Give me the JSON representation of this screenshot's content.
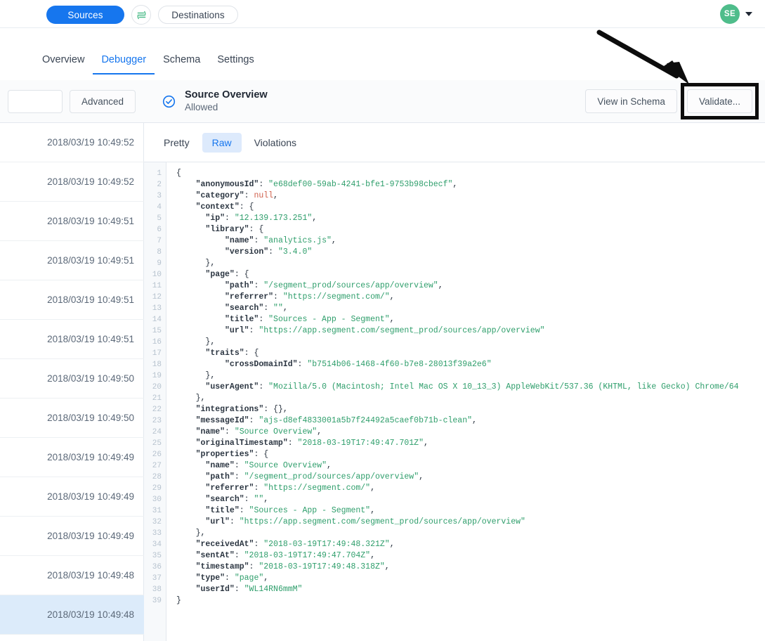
{
  "topbar": {
    "sources_label": "Sources",
    "destinations_label": "Destinations",
    "sync_icon": "sync-icon",
    "avatar_initials": "SE",
    "caret_icon": "chevron-down-icon"
  },
  "nav": {
    "tabs": [
      {
        "label": "Overview",
        "active": false
      },
      {
        "label": "Debugger",
        "active": true
      },
      {
        "label": "Schema",
        "active": false
      },
      {
        "label": "Settings",
        "active": false
      }
    ]
  },
  "left_panel": {
    "search_value": "",
    "search_placeholder": "",
    "advanced_label": "Advanced",
    "events": [
      {
        "timestamp": "2018/03/19 10:49:52",
        "selected": false
      },
      {
        "timestamp": "2018/03/19 10:49:52",
        "selected": false
      },
      {
        "timestamp": "2018/03/19 10:49:51",
        "selected": false
      },
      {
        "timestamp": "2018/03/19 10:49:51",
        "selected": false
      },
      {
        "timestamp": "2018/03/19 10:49:51",
        "selected": false
      },
      {
        "timestamp": "2018/03/19 10:49:51",
        "selected": false
      },
      {
        "timestamp": "2018/03/19 10:49:50",
        "selected": false
      },
      {
        "timestamp": "2018/03/19 10:49:50",
        "selected": false
      },
      {
        "timestamp": "2018/03/19 10:49:49",
        "selected": false
      },
      {
        "timestamp": "2018/03/19 10:49:49",
        "selected": false
      },
      {
        "timestamp": "2018/03/19 10:49:49",
        "selected": false
      },
      {
        "timestamp": "2018/03/19 10:49:48",
        "selected": false
      },
      {
        "timestamp": "2018/03/19 10:49:48",
        "selected": true
      }
    ]
  },
  "detail": {
    "status_icon": "check-circle-icon",
    "title": "Source Overview",
    "subtitle": "Allowed",
    "view_in_schema_label": "View in Schema",
    "validate_label": "Validate...",
    "view_tabs": [
      {
        "label": "Pretty",
        "active": false
      },
      {
        "label": "Raw",
        "active": true
      },
      {
        "label": "Violations",
        "active": false
      }
    ]
  },
  "annotation": {
    "arrow_icon": "arrow-pointer-icon",
    "highlight_target": "validate-button"
  },
  "code": {
    "lines": [
      {
        "num": "1",
        "tokens": [
          {
            "t": "{",
            "c": "p",
            "indent": 0
          }
        ]
      },
      {
        "num": "2",
        "tokens": [
          {
            "t": "\"anonymousId\"",
            "c": "k",
            "indent": 2
          },
          {
            "t": ": ",
            "c": "p"
          },
          {
            "t": "\"e68def00-59ab-4241-bfe1-9753b98cbecf\"",
            "c": "s"
          },
          {
            "t": ",",
            "c": "p"
          }
        ]
      },
      {
        "num": "3",
        "tokens": [
          {
            "t": "\"category\"",
            "c": "k",
            "indent": 2
          },
          {
            "t": ": ",
            "c": "p"
          },
          {
            "t": "null",
            "c": "n"
          },
          {
            "t": ",",
            "c": "p"
          }
        ]
      },
      {
        "num": "4",
        "tokens": [
          {
            "t": "\"context\"",
            "c": "k",
            "indent": 2
          },
          {
            "t": ": {",
            "c": "p"
          }
        ]
      },
      {
        "num": "5",
        "tokens": [
          {
            "t": "\"ip\"",
            "c": "k",
            "indent": 3
          },
          {
            "t": ": ",
            "c": "p"
          },
          {
            "t": "\"12.139.173.251\"",
            "c": "s"
          },
          {
            "t": ",",
            "c": "p"
          }
        ]
      },
      {
        "num": "6",
        "tokens": [
          {
            "t": "\"library\"",
            "c": "k",
            "indent": 3
          },
          {
            "t": ": {",
            "c": "p"
          }
        ]
      },
      {
        "num": "7",
        "tokens": [
          {
            "t": "\"name\"",
            "c": "k",
            "indent": 5
          },
          {
            "t": ": ",
            "c": "p"
          },
          {
            "t": "\"analytics.js\"",
            "c": "s"
          },
          {
            "t": ",",
            "c": "p"
          }
        ]
      },
      {
        "num": "8",
        "tokens": [
          {
            "t": "\"version\"",
            "c": "k",
            "indent": 5
          },
          {
            "t": ": ",
            "c": "p"
          },
          {
            "t": "\"3.4.0\"",
            "c": "s"
          }
        ]
      },
      {
        "num": "9",
        "tokens": [
          {
            "t": "},",
            "c": "p",
            "indent": 3
          }
        ]
      },
      {
        "num": "10",
        "tokens": [
          {
            "t": "\"page\"",
            "c": "k",
            "indent": 3
          },
          {
            "t": ": {",
            "c": "p"
          }
        ]
      },
      {
        "num": "11",
        "tokens": [
          {
            "t": "\"path\"",
            "c": "k",
            "indent": 5
          },
          {
            "t": ": ",
            "c": "p"
          },
          {
            "t": "\"/segment_prod/sources/app/overview\"",
            "c": "s"
          },
          {
            "t": ",",
            "c": "p"
          }
        ]
      },
      {
        "num": "12",
        "tokens": [
          {
            "t": "\"referrer\"",
            "c": "k",
            "indent": 5
          },
          {
            "t": ": ",
            "c": "p"
          },
          {
            "t": "\"https://segment.com/\"",
            "c": "s"
          },
          {
            "t": ",",
            "c": "p"
          }
        ]
      },
      {
        "num": "13",
        "tokens": [
          {
            "t": "\"search\"",
            "c": "k",
            "indent": 5
          },
          {
            "t": ": ",
            "c": "p"
          },
          {
            "t": "\"\"",
            "c": "s"
          },
          {
            "t": ",",
            "c": "p"
          }
        ]
      },
      {
        "num": "14",
        "tokens": [
          {
            "t": "\"title\"",
            "c": "k",
            "indent": 5
          },
          {
            "t": ": ",
            "c": "p"
          },
          {
            "t": "\"Sources - App - Segment\"",
            "c": "s"
          },
          {
            "t": ",",
            "c": "p"
          }
        ]
      },
      {
        "num": "15",
        "tokens": [
          {
            "t": "\"url\"",
            "c": "k",
            "indent": 5
          },
          {
            "t": ": ",
            "c": "p"
          },
          {
            "t": "\"https://app.segment.com/segment_prod/sources/app/overview\"",
            "c": "s"
          }
        ]
      },
      {
        "num": "16",
        "tokens": [
          {
            "t": "},",
            "c": "p",
            "indent": 3
          }
        ]
      },
      {
        "num": "17",
        "tokens": [
          {
            "t": "\"traits\"",
            "c": "k",
            "indent": 3
          },
          {
            "t": ": {",
            "c": "p"
          }
        ]
      },
      {
        "num": "18",
        "tokens": [
          {
            "t": "\"crossDomainId\"",
            "c": "k",
            "indent": 5
          },
          {
            "t": ": ",
            "c": "p"
          },
          {
            "t": "\"b7514b06-1468-4f60-b7e8-28013f39a2e6\"",
            "c": "s"
          }
        ]
      },
      {
        "num": "19",
        "tokens": [
          {
            "t": "},",
            "c": "p",
            "indent": 3
          }
        ]
      },
      {
        "num": "20",
        "tokens": [
          {
            "t": "\"userAgent\"",
            "c": "k",
            "indent": 3
          },
          {
            "t": ": ",
            "c": "p"
          },
          {
            "t": "\"Mozilla/5.0 (Macintosh; Intel Mac OS X 10_13_3) AppleWebKit/537.36 (KHTML, like Gecko) Chrome/64",
            "c": "s"
          }
        ]
      },
      {
        "num": "21",
        "tokens": [
          {
            "t": "},",
            "c": "p",
            "indent": 2
          }
        ]
      },
      {
        "num": "22",
        "tokens": [
          {
            "t": "\"integrations\"",
            "c": "k",
            "indent": 2
          },
          {
            "t": ": {},",
            "c": "p"
          }
        ]
      },
      {
        "num": "23",
        "tokens": [
          {
            "t": "\"messageId\"",
            "c": "k",
            "indent": 2
          },
          {
            "t": ": ",
            "c": "p"
          },
          {
            "t": "\"ajs-d8ef4833001a5b7f24492a5caef0b71b-clean\"",
            "c": "s"
          },
          {
            "t": ",",
            "c": "p"
          }
        ]
      },
      {
        "num": "24",
        "tokens": [
          {
            "t": "\"name\"",
            "c": "k",
            "indent": 2
          },
          {
            "t": ": ",
            "c": "p"
          },
          {
            "t": "\"Source Overview\"",
            "c": "s"
          },
          {
            "t": ",",
            "c": "p"
          }
        ]
      },
      {
        "num": "25",
        "tokens": [
          {
            "t": "\"originalTimestamp\"",
            "c": "k",
            "indent": 2
          },
          {
            "t": ": ",
            "c": "p"
          },
          {
            "t": "\"2018-03-19T17:49:47.701Z\"",
            "c": "s"
          },
          {
            "t": ",",
            "c": "p"
          }
        ]
      },
      {
        "num": "26",
        "tokens": [
          {
            "t": "\"properties\"",
            "c": "k",
            "indent": 2
          },
          {
            "t": ": {",
            "c": "p"
          }
        ]
      },
      {
        "num": "27",
        "tokens": [
          {
            "t": "\"name\"",
            "c": "k",
            "indent": 3
          },
          {
            "t": ": ",
            "c": "p"
          },
          {
            "t": "\"Source Overview\"",
            "c": "s"
          },
          {
            "t": ",",
            "c": "p"
          }
        ]
      },
      {
        "num": "28",
        "tokens": [
          {
            "t": "\"path\"",
            "c": "k",
            "indent": 3
          },
          {
            "t": ": ",
            "c": "p"
          },
          {
            "t": "\"/segment_prod/sources/app/overview\"",
            "c": "s"
          },
          {
            "t": ",",
            "c": "p"
          }
        ]
      },
      {
        "num": "29",
        "tokens": [
          {
            "t": "\"referrer\"",
            "c": "k",
            "indent": 3
          },
          {
            "t": ": ",
            "c": "p"
          },
          {
            "t": "\"https://segment.com/\"",
            "c": "s"
          },
          {
            "t": ",",
            "c": "p"
          }
        ]
      },
      {
        "num": "30",
        "tokens": [
          {
            "t": "\"search\"",
            "c": "k",
            "indent": 3
          },
          {
            "t": ": ",
            "c": "p"
          },
          {
            "t": "\"\"",
            "c": "s"
          },
          {
            "t": ",",
            "c": "p"
          }
        ]
      },
      {
        "num": "31",
        "tokens": [
          {
            "t": "\"title\"",
            "c": "k",
            "indent": 3
          },
          {
            "t": ": ",
            "c": "p"
          },
          {
            "t": "\"Sources - App - Segment\"",
            "c": "s"
          },
          {
            "t": ",",
            "c": "p"
          }
        ]
      },
      {
        "num": "32",
        "tokens": [
          {
            "t": "\"url\"",
            "c": "k",
            "indent": 3
          },
          {
            "t": ": ",
            "c": "p"
          },
          {
            "t": "\"https://app.segment.com/segment_prod/sources/app/overview\"",
            "c": "s"
          }
        ]
      },
      {
        "num": "33",
        "tokens": [
          {
            "t": "},",
            "c": "p",
            "indent": 2
          }
        ]
      },
      {
        "num": "34",
        "tokens": [
          {
            "t": "\"receivedAt\"",
            "c": "k",
            "indent": 2
          },
          {
            "t": ": ",
            "c": "p"
          },
          {
            "t": "\"2018-03-19T17:49:48.321Z\"",
            "c": "s"
          },
          {
            "t": ",",
            "c": "p"
          }
        ]
      },
      {
        "num": "35",
        "tokens": [
          {
            "t": "\"sentAt\"",
            "c": "k",
            "indent": 2
          },
          {
            "t": ": ",
            "c": "p"
          },
          {
            "t": "\"2018-03-19T17:49:47.704Z\"",
            "c": "s"
          },
          {
            "t": ",",
            "c": "p"
          }
        ]
      },
      {
        "num": "36",
        "tokens": [
          {
            "t": "\"timestamp\"",
            "c": "k",
            "indent": 2
          },
          {
            "t": ": ",
            "c": "p"
          },
          {
            "t": "\"2018-03-19T17:49:48.318Z\"",
            "c": "s"
          },
          {
            "t": ",",
            "c": "p"
          }
        ]
      },
      {
        "num": "37",
        "tokens": [
          {
            "t": "\"type\"",
            "c": "k",
            "indent": 2
          },
          {
            "t": ": ",
            "c": "p"
          },
          {
            "t": "\"page\"",
            "c": "s"
          },
          {
            "t": ",",
            "c": "p"
          }
        ]
      },
      {
        "num": "38",
        "tokens": [
          {
            "t": "\"userId\"",
            "c": "k",
            "indent": 2
          },
          {
            "t": ": ",
            "c": "p"
          },
          {
            "t": "\"WL14RN6mmM\"",
            "c": "s"
          }
        ]
      },
      {
        "num": "39",
        "tokens": [
          {
            "t": "}",
            "c": "p",
            "indent": 0
          }
        ]
      }
    ]
  },
  "colors": {
    "accent": "#1676ee",
    "avatar": "#4fbd8b",
    "string": "#2e9e6b",
    "null": "#d0604c",
    "selected_row": "#dcebfa",
    "annotation": "#0d0d0d"
  }
}
